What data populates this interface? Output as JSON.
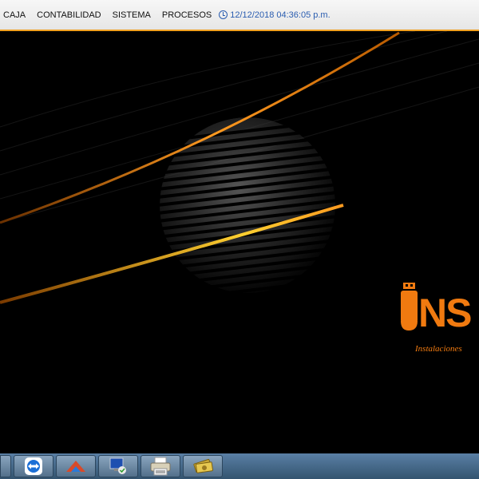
{
  "menu": {
    "items": [
      {
        "label": "CAJA"
      },
      {
        "label": "CONTABILIDAD"
      },
      {
        "label": "SISTEMA"
      },
      {
        "label": "PROCESOS"
      }
    ],
    "datetime": "12/12/2018 04:36:05 p.m."
  },
  "logo": {
    "letters": "NS",
    "tagline": "Instalaciones"
  },
  "taskbar": {
    "apps": [
      {
        "icon": "teamviewer-icon"
      },
      {
        "icon": "app-arrow-icon"
      },
      {
        "icon": "monitor-network-icon"
      },
      {
        "icon": "printer-icon"
      },
      {
        "icon": "money-icon"
      }
    ]
  },
  "colors": {
    "accent_orange": "#f07a10",
    "clock_blue": "#2a5db0",
    "taskbar": "#3f6485"
  }
}
